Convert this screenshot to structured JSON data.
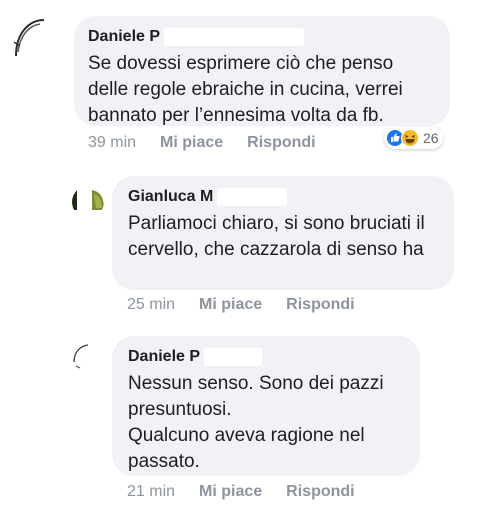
{
  "comments": [
    {
      "author": "Daniele P",
      "text": "Se dovessi esprimere ciò che penso delle regole ebraiche in cucina, verrei bannato per l’ennesima volta da fb.",
      "time": "39 min",
      "like_label": "Mi piace",
      "reply_label": "Rispondi",
      "reaction_count": "26",
      "reaction_icons": [
        "like-icon",
        "haha-icon"
      ]
    },
    {
      "author": "Gianluca M",
      "text": "Parliamoci chiaro, si sono bruciati il cervello, che cazzarola di senso ha",
      "time": "25 min",
      "like_label": "Mi piace",
      "reply_label": "Rispondi"
    },
    {
      "author": "Daniele P",
      "text": "Nessun senso. Sono dei pazzi presuntuosi.\nQualcuno aveva ragione nel passato.",
      "time": "21 min",
      "like_label": "Mi piace",
      "reply_label": "Rispondi"
    }
  ],
  "colors": {
    "bubble": "#f1f2f6",
    "meta": "#8d949e",
    "like_reaction": "#1877f2",
    "haha_reaction": "#f7b928"
  }
}
